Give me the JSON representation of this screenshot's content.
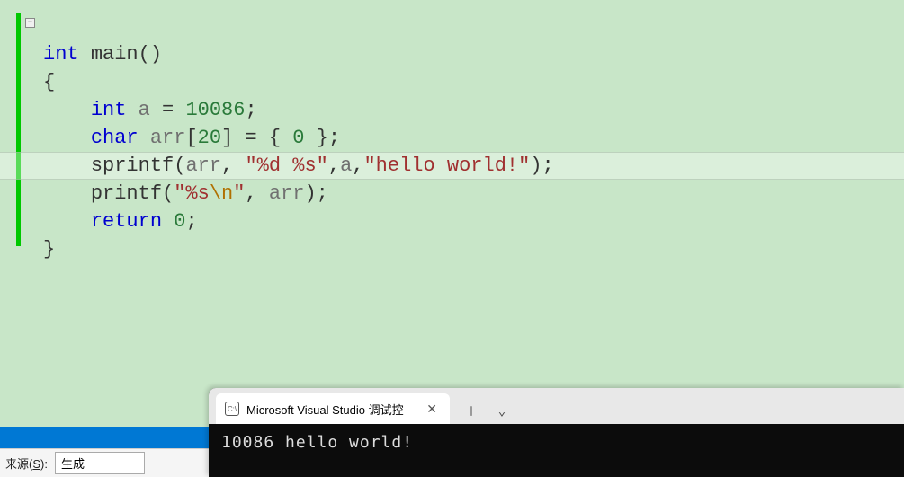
{
  "code": {
    "line1": {
      "kw1": "int",
      "func": "main",
      "paren": "()"
    },
    "line2": {
      "brace": "{"
    },
    "line3": {
      "indent": "    ",
      "kw": "int",
      "sp1": " ",
      "ident": "a",
      "sp2": " ",
      "eq": "=",
      "sp3": " ",
      "num": "10086",
      "semi": ";"
    },
    "line4": {
      "indent": "    ",
      "kw": "char",
      "sp1": " ",
      "ident": "arr",
      "bracket": "[",
      "size": "20",
      "bracket2": "]",
      "sp2": " ",
      "eq": "=",
      "sp3": " ",
      "brace1": "{",
      "sp4": " ",
      "zero": "0",
      "sp5": " ",
      "brace2": "}",
      "semi": ";"
    },
    "line5": {
      "indent": "    ",
      "func": "sprintf",
      "paren1": "(",
      "arg1": "arr",
      "comma1": ",",
      "sp1": " ",
      "str1": "\"%d %s\"",
      "comma2": ",",
      "arg2": "a",
      "comma3": ",",
      "str2": "\"hello world!\"",
      "paren2": ")",
      "semi": ";"
    },
    "line6": {
      "indent": "    ",
      "func": "printf",
      "paren1": "(",
      "str1a": "\"%s",
      "esc": "\\n",
      "str1b": "\"",
      "comma": ",",
      "sp": " ",
      "arg": "arr",
      "paren2": ")",
      "semi": ";"
    },
    "line7": {
      "indent": "    ",
      "kw": "return",
      "sp": " ",
      "num": "0",
      "semi": ";"
    },
    "line8": {
      "brace": "}"
    }
  },
  "bottom": {
    "source_label_pre": "来源(",
    "source_label_u": "S",
    "source_label_post": "):",
    "dropdown_value": "生成"
  },
  "terminal": {
    "tab_title": "Microsoft Visual Studio 调试控",
    "tab_icon_text": "C:\\",
    "output": "10086 hello world!"
  }
}
